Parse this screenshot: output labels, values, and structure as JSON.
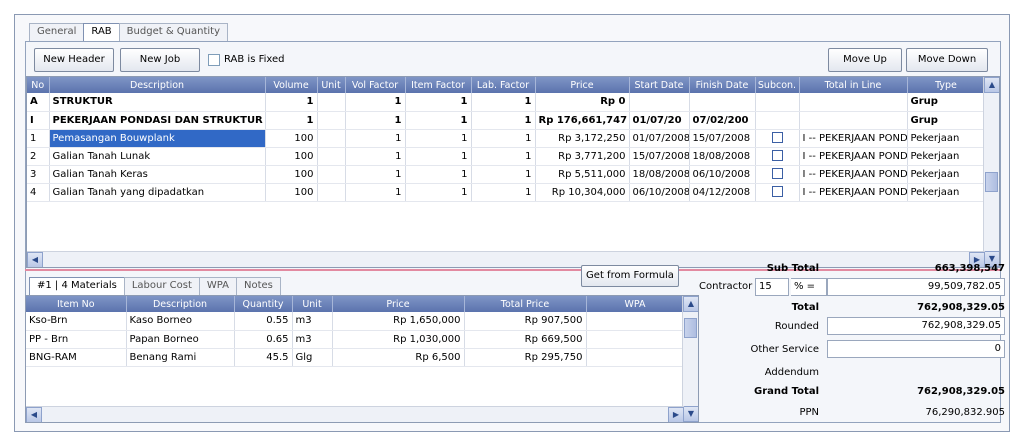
{
  "tabs": [
    "General",
    "RAB",
    "Budget & Quantity"
  ],
  "toolbar": {
    "new_header": "New Header",
    "new_job": "New Job",
    "rab_fixed": "RAB is Fixed",
    "move_up": "Move Up",
    "move_down": "Move Down"
  },
  "rab_columns": [
    "No",
    "Description",
    "Volume",
    "Unit",
    "Vol Factor",
    "Item Factor",
    "Lab. Factor",
    "Price",
    "Start Date",
    "Finish Date",
    "Subcon.",
    "Total in Line",
    "Type"
  ],
  "rab_rows": [
    {
      "no": "A",
      "desc": "STRUKTUR",
      "volume": "1",
      "unit": "",
      "vol_factor": "1",
      "item_factor": "1",
      "lab_factor": "1",
      "price": "Rp 0",
      "start": "",
      "finish": "",
      "subcon": false,
      "total": "",
      "type": "Grup",
      "bold": true
    },
    {
      "no": "I",
      "desc": "PEKERJAAN PONDASI DAN STRUKTUR",
      "volume": "1",
      "unit": "",
      "vol_factor": "1",
      "item_factor": "1",
      "lab_factor": "1",
      "price": "Rp 176,661,747",
      "start": "01/07/20",
      "finish": "07/02/200",
      "subcon": false,
      "total": "",
      "type": "Grup",
      "bold": true
    },
    {
      "no": "1",
      "desc": "Pemasangan Bouwplank",
      "volume": "100",
      "unit": "",
      "vol_factor": "1",
      "item_factor": "1",
      "lab_factor": "1",
      "price": "Rp 3,172,250",
      "start": "01/07/2008",
      "finish": "15/07/2008",
      "subcon": true,
      "total": "I -- PEKERJAAN PONDASI",
      "type": "Pekerjaan",
      "bold": false,
      "selected": true
    },
    {
      "no": "2",
      "desc": "Galian Tanah Lunak",
      "volume": "100",
      "unit": "",
      "vol_factor": "1",
      "item_factor": "1",
      "lab_factor": "1",
      "price": "Rp 3,771,200",
      "start": "15/07/2008",
      "finish": "18/08/2008",
      "subcon": true,
      "total": "I -- PEKERJAAN PONDASI",
      "type": "Pekerjaan",
      "bold": false
    },
    {
      "no": "3",
      "desc": "Galian Tanah Keras",
      "volume": "100",
      "unit": "",
      "vol_factor": "1",
      "item_factor": "1",
      "lab_factor": "1",
      "price": "Rp 5,511,000",
      "start": "18/08/2008",
      "finish": "06/10/2008",
      "subcon": true,
      "total": "I -- PEKERJAAN PONDASI",
      "type": "Pekerjaan",
      "bold": false
    },
    {
      "no": "4",
      "desc": "Galian Tanah yang dipadatkan",
      "volume": "100",
      "unit": "",
      "vol_factor": "1",
      "item_factor": "1",
      "lab_factor": "1",
      "price": "Rp 10,304,000",
      "start": "06/10/2008",
      "finish": "04/12/2008",
      "subcon": true,
      "total": "I -- PEKERJAAN PONDASI",
      "type": "Pekerjaan",
      "bold": false
    }
  ],
  "sub_tabs": [
    "#1 | 4 Materials",
    "Labour Cost",
    "WPA",
    "Notes"
  ],
  "get_formula": "Get from Formula",
  "material_columns": [
    "Item No",
    "Description",
    "Quantity",
    "Unit",
    "Price",
    "Total Price",
    "WPA"
  ],
  "material_rows": [
    {
      "item": "Kso-Brn",
      "desc": "Kaso Borneo",
      "qty": "0.55",
      "unit": "m3",
      "price": "Rp 1,650,000",
      "total": "Rp 907,500",
      "wpa": ""
    },
    {
      "item": "PP - Brn",
      "desc": "Papan Borneo",
      "qty": "0.65",
      "unit": "m3",
      "price": "Rp 1,030,000",
      "total": "Rp 669,500",
      "wpa": ""
    },
    {
      "item": "BNG-RAM",
      "desc": "Benang Rami",
      "qty": "45.5",
      "unit": "Glg",
      "price": "Rp 6,500",
      "total": "Rp 295,750",
      "wpa": ""
    }
  ],
  "summary": {
    "sub_total_label": "Sub Total",
    "sub_total": "663,398,547",
    "contractor_label": "Contractor",
    "contractor_pct": "15",
    "pct_eq": "% =",
    "contractor_value": "99,509,782.05",
    "total_label": "Total",
    "total": "762,908,329.05",
    "rounded_label": "Rounded",
    "rounded": "762,908,329.05",
    "other_label": "Other Service",
    "other": "0",
    "addendum_label": "Addendum",
    "grand_label": "Grand Total",
    "grand": "762,908,329.05",
    "ppn_label": "PPN",
    "ppn": "76,290,832.905"
  }
}
